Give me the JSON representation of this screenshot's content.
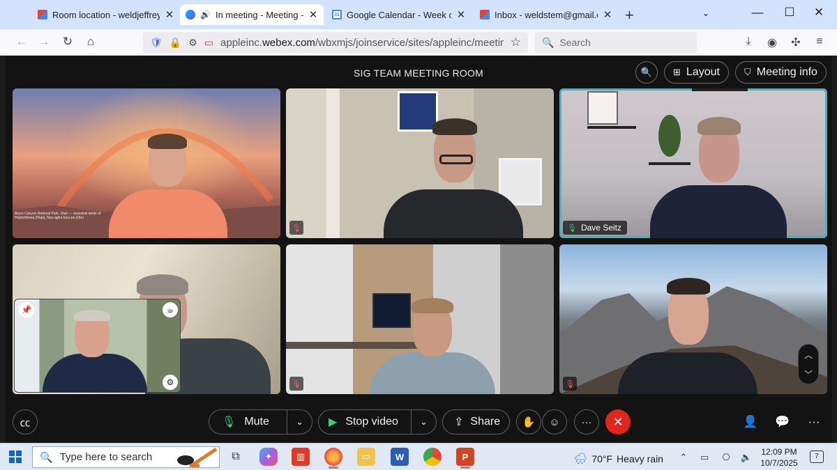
{
  "browser": {
    "tabs": [
      {
        "title": "Room location - weldjeffrey@gm",
        "favicon": "gmail-icon"
      },
      {
        "title": "In meeting - Meeting - Webe",
        "favicon": "webex-icon",
        "audio": true,
        "active": true
      },
      {
        "title": "Google Calendar - Week of Oct",
        "favicon": "google-calendar-icon",
        "favicon_text": "31"
      },
      {
        "title": "Inbox - weldstem@gmail.com -",
        "favicon": "gmail-icon"
      }
    ],
    "url_prefix": "appleinc.",
    "url_domain": "webex.com",
    "url_path": "/wbxmjs/joinservice/sites/appleinc/meeting/downloa",
    "search_placeholder": "Search"
  },
  "meeting": {
    "title": "SIG TEAM MEETING ROOM",
    "layout_label": "Layout",
    "info_label": "Meeting info",
    "tile1_caption": "Bryce Canyon National Park, Utah — ancestral lands of Hopituhbeeq (Hopi), Nuu-agha-tuvu-pu (Ute)",
    "active_speaker": "Dave Seitz",
    "highlight_color": "#4fb0b9",
    "controls": {
      "mute_label": "Mute",
      "video_label": "Stop video",
      "share_label": "Share"
    },
    "end_color": "#e1261c"
  },
  "taskbar": {
    "search_placeholder": "Type here to search",
    "weather_temp": "70°F",
    "weather_desc": "Heavy rain",
    "time": "12:09 PM",
    "date": "10/7/2025",
    "notifications": "7"
  }
}
